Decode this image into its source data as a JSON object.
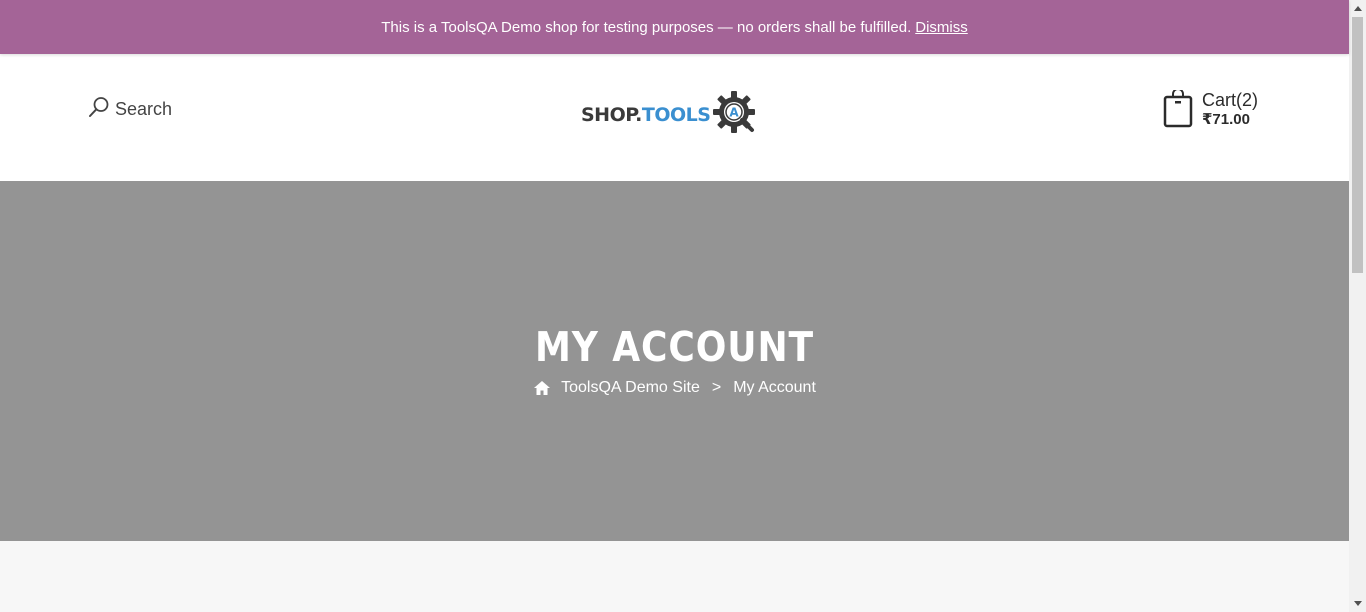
{
  "notice": {
    "message": "This is a ToolsQA Demo shop for testing purposes — no orders shall be fulfilled.",
    "dismiss_label": "Dismiss",
    "background_color": "#a46497"
  },
  "header": {
    "search_label": "Search",
    "search_icon": "search-icon",
    "logo": {
      "part1": "SHOP.",
      "part2": "TOOLS",
      "badge_letter": "A"
    },
    "cart": {
      "label": "Cart(2)",
      "total": "₹71.00",
      "icon": "shopping-bag-icon"
    }
  },
  "hero": {
    "title": "MY ACCOUNT",
    "background_color": "#949494",
    "breadcrumb": {
      "home_icon": "home-icon",
      "home_label": "ToolsQA Demo Site",
      "separator": ">",
      "current": "My Account"
    }
  }
}
